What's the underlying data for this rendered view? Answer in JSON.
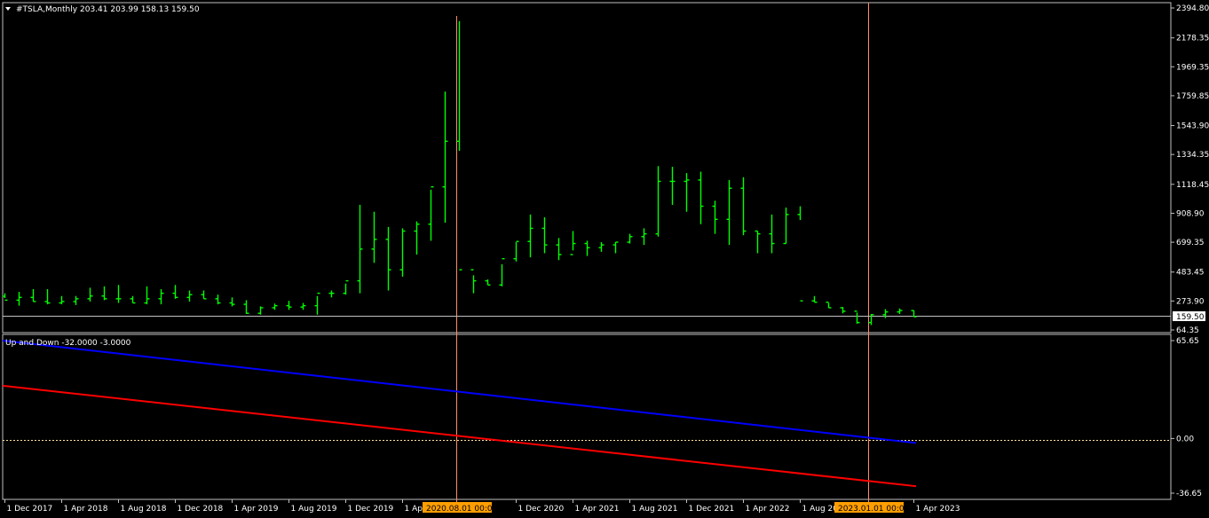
{
  "header": {
    "symbol_line": "#TSLA,Monthly",
    "ohlc": "203.41 203.99 158.13 159.50"
  },
  "indicator_title": "Up and Down -32.0000 -3.0000",
  "current_price_label": "159.50",
  "crosshair_labels": [
    "2020.08.01 00:00",
    "2023.01.01 00:00"
  ],
  "colors": {
    "background": "#000000",
    "bars": "#00ff00",
    "up_line": "#0000ff",
    "down_line": "#ff0000",
    "crosshair": "#ff8c69",
    "tag_bg": "#ff9e00"
  },
  "chart_data": [
    {
      "type": "ohlc",
      "title": "#TSLA,Monthly",
      "x": [
        "2017-12",
        "2018-01",
        "2018-02",
        "2018-03",
        "2018-04",
        "2018-05",
        "2018-06",
        "2018-07",
        "2018-08",
        "2018-09",
        "2018-10",
        "2018-11",
        "2018-12",
        "2019-01",
        "2019-02",
        "2019-03",
        "2019-04",
        "2019-05",
        "2019-06",
        "2019-07",
        "2019-08",
        "2019-09",
        "2019-10",
        "2019-11",
        "2019-12",
        "2020-01",
        "2020-02",
        "2020-03",
        "2020-04",
        "2020-05",
        "2020-06",
        "2020-07",
        "2020-08",
        "2020-09",
        "2020-10",
        "2020-11",
        "2020-12",
        "2021-01",
        "2021-02",
        "2021-03",
        "2021-04",
        "2021-05",
        "2021-06",
        "2021-07",
        "2021-08",
        "2021-09",
        "2021-10",
        "2021-11",
        "2021-12",
        "2022-01",
        "2022-02",
        "2022-03",
        "2022-04",
        "2022-05",
        "2022-06",
        "2022-07",
        "2022-08",
        "2022-09",
        "2022-10",
        "2022-11",
        "2022-12",
        "2023-01",
        "2023-02",
        "2023-03",
        "2023-04"
      ],
      "open": [
        308,
        280,
        300,
        270,
        260,
        270,
        290,
        310,
        290,
        290,
        260,
        290,
        330,
        300,
        320,
        290,
        260,
        250,
        185,
        225,
        240,
        230,
        240,
        330,
        330,
        420,
        650,
        720,
        500,
        780,
        830,
        1100,
        1430,
        500,
        420,
        390,
        580,
        705,
        800,
        680,
        610,
        690,
        660,
        680,
        700,
        740,
        760,
        1140,
        1140,
        1150,
        960,
        865,
        1090,
        780,
        760,
        690,
        900,
        275,
        265,
        225,
        200,
        118,
        175,
        195,
        205
      ],
      "high": [
        330,
        340,
        360,
        360,
        310,
        310,
        370,
        380,
        390,
        310,
        380,
        360,
        390,
        350,
        350,
        320,
        300,
        280,
        235,
        255,
        275,
        260,
        310,
        350,
        400,
        970,
        920,
        810,
        800,
        850,
        1080,
        1790,
        2300,
        460,
        430,
        540,
        700,
        900,
        880,
        730,
        780,
        710,
        700,
        700,
        760,
        800,
        1250,
        1245,
        1200,
        1210,
        1000,
        1150,
        1170,
        780,
        900,
        950,
        960,
        310,
        260,
        230,
        190,
        180,
        215,
        220,
        205
      ],
      "low": [
        295,
        240,
        270,
        250,
        250,
        245,
        270,
        280,
        260,
        260,
        250,
        250,
        290,
        270,
        290,
        250,
        235,
        180,
        175,
        210,
        210,
        210,
        175,
        300,
        320,
        330,
        550,
        350,
        450,
        610,
        710,
        840,
        1360,
        330,
        390,
        380,
        560,
        590,
        620,
        570,
        640,
        600,
        630,
        620,
        690,
        680,
        740,
        970,
        920,
        830,
        760,
        680,
        750,
        620,
        620,
        690,
        860,
        265,
        225,
        185,
        110,
        100,
        150,
        180,
        160
      ],
      "close": [
        280,
        300,
        270,
        260,
        270,
        290,
        310,
        290,
        290,
        260,
        290,
        330,
        300,
        320,
        290,
        260,
        250,
        185,
        225,
        240,
        230,
        240,
        330,
        330,
        420,
        650,
        720,
        500,
        780,
        830,
        1100,
        1430,
        500,
        420,
        390,
        580,
        705,
        800,
        680,
        610,
        690,
        660,
        680,
        700,
        740,
        760,
        1140,
        1140,
        1150,
        960,
        865,
        1090,
        780,
        760,
        690,
        900,
        275,
        265,
        225,
        200,
        118,
        175,
        195,
        205,
        160
      ],
      "ylim": [
        64.35,
        2394.8
      ],
      "y_ticks": [
        "2394.80",
        "2178.35",
        "1969.35",
        "1759.85",
        "1543.90",
        "1334.35",
        "1118.45",
        "908.90",
        "699.35",
        "483.45",
        "273.90",
        "64.35"
      ],
      "x_ticks": [
        "1 Dec 2017",
        "1 Apr 2018",
        "1 Aug 2018",
        "1 Dec 2018",
        "1 Apr 2019",
        "1 Aug 2019",
        "1 Dec 2019",
        "1 Apr",
        "1 Dec 2020",
        "1 Apr 2021",
        "1 Aug 2021",
        "1 Dec 2021",
        "1 Apr 2022",
        "1 Aug 202",
        "1 Apr 2023"
      ],
      "current_price": 159.5
    },
    {
      "type": "line",
      "title": "Up and Down -32.0000 -3.0000",
      "series": [
        {
          "color": "#0000ff",
          "start": 65.65,
          "end": -3.0
        },
        {
          "color": "#ff0000",
          "start": 35.4,
          "end": -32.0
        }
      ],
      "ylim": [
        -36.65,
        65.65
      ],
      "y_ticks": [
        "65.65",
        "0.00",
        "-36.65"
      ],
      "zero_line": 0
    }
  ]
}
